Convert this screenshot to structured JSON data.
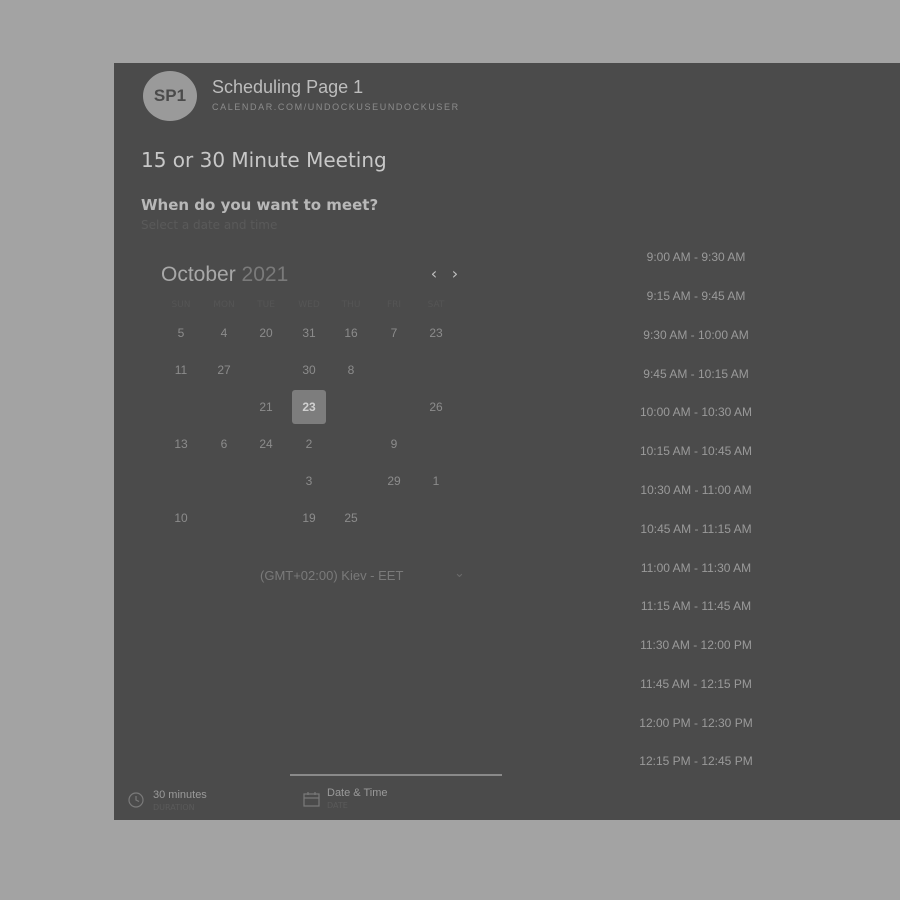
{
  "header": {
    "avatar_initials": "SP1",
    "title": "Scheduling Page 1",
    "url": "CALENDAR.COM/UNDOCKUSEUNDOCKUSER"
  },
  "meeting_title": "15 or 30 Minute Meeting",
  "question": "When do you want to meet?",
  "hint": "Select a date and time",
  "calendar": {
    "month": "October",
    "year": "2021",
    "weekdays": [
      "SUN",
      "MON",
      "TUE",
      "WED",
      "THU",
      "FRI",
      "SAT"
    ],
    "days": [
      "5",
      "4",
      "20",
      "31",
      "16",
      "7",
      "23",
      "11",
      "27",
      "30",
      "8",
      "21",
      "23",
      "26",
      "13",
      "6",
      "24",
      "2",
      "9",
      "3",
      "29",
      "1",
      "10",
      "19",
      "25"
    ],
    "selected_day": "23"
  },
  "timezone": "(GMT+02:00) Kiev - EET",
  "slots": [
    "9:00 AM - 9:30 AM",
    "9:15 AM - 9:45 AM",
    "9:30 AM - 10:00 AM",
    "9:45 AM - 10:15 AM",
    "10:00 AM - 10:30 AM",
    "10:15 AM - 10:45 AM",
    "10:30 AM - 11:00 AM",
    "10:45 AM - 11:15 AM",
    "11:00 AM - 11:30 AM",
    "11:15 AM - 11:45 AM",
    "11:30 AM - 12:00 PM",
    "11:45 AM - 12:15 PM",
    "12:00 PM - 12:30 PM",
    "12:15 PM - 12:45 PM"
  ],
  "footer": {
    "duration_label": "30 minutes",
    "duration_sub": "DURATION",
    "date_label": "Date & Time",
    "date_sub": "DATE"
  },
  "icons": {
    "nav_prev": "chevron-left-icon",
    "nav_next": "chevron-right-icon",
    "timezone": "chevron-down-icon",
    "duration": "clock-icon",
    "date": "calendar-icon"
  }
}
